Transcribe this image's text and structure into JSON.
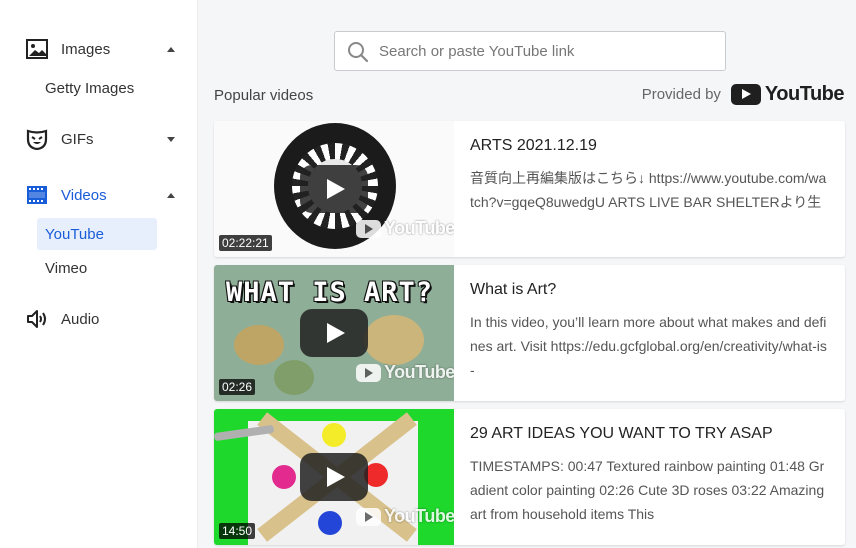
{
  "sidebar": {
    "items": [
      {
        "label": "Images",
        "icon": "image-icon",
        "expanded": true,
        "sub": [
          "Getty Images"
        ]
      },
      {
        "label": "GIFs",
        "icon": "gif-mask-icon",
        "expanded": false
      },
      {
        "label": "Videos",
        "icon": "film-icon",
        "expanded": true,
        "active": true,
        "sub": [
          "YouTube",
          "Vimeo"
        ]
      },
      {
        "label": "Audio",
        "icon": "speaker-icon"
      }
    ]
  },
  "search": {
    "placeholder": "Search or paste YouTube link",
    "value": ""
  },
  "main": {
    "section_title": "Popular videos",
    "provided_by": "Provided by",
    "provider_logo": "YouTube"
  },
  "videos": [
    {
      "title": "ARTS 2021.12.19",
      "description": "音質向上再編集版はこちら↓ https://www.youtube.com/watch?v=gqeQ8uwedgU ARTS LIVE BAR SHELTERより生",
      "duration": "02:22:21"
    },
    {
      "title": "What is Art?",
      "description": "In this video, you’ll learn more about what makes and defines art. Visit https://edu.gcfglobal.org/en/creativity/what-is-",
      "duration": "02:26",
      "thumb_text": "WHAT IS ART?"
    },
    {
      "title": "29 ART IDEAS YOU WANT TO TRY ASAP",
      "description": "TIMESTAMPS: 00:47 Textured rainbow painting 01:48 Gradient color painting 02:26 Cute 3D roses 03:22 Amazing art from household items This",
      "duration": "14:50"
    }
  ],
  "watermark": "YouTube",
  "colors": {
    "accent": "#1a5dd8",
    "selected_bg": "#e7effc",
    "main_bg": "#f5f6f7"
  }
}
